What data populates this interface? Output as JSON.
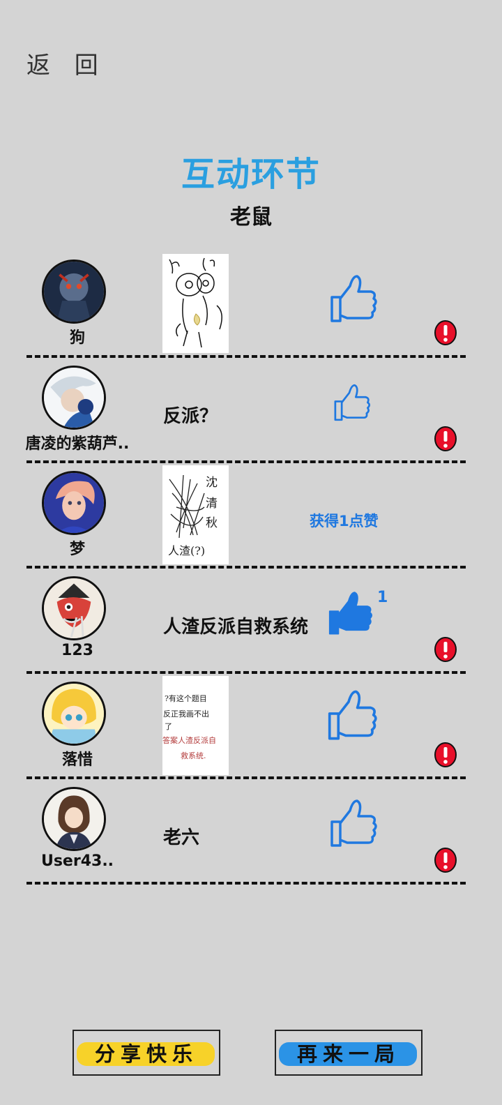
{
  "header": {
    "back_label": "返 回"
  },
  "title": "互动环节",
  "word": "老鼠",
  "players": [
    {
      "name": "狗",
      "answer_type": "drawing",
      "answer": "",
      "like_state": "outline",
      "like_count": "",
      "report": true
    },
    {
      "name": "唐凌的紫葫芦..",
      "answer_type": "text",
      "answer": "反派？",
      "like_state": "outline",
      "like_count": "",
      "report": true
    },
    {
      "name": "梦",
      "answer_type": "drawing",
      "answer": "",
      "like_state": "received",
      "like_text": "获得1点赞",
      "report": false
    },
    {
      "name": "123",
      "answer_type": "text",
      "answer": "人渣反派自救系统",
      "like_state": "filled",
      "like_count": "1",
      "report": true
    },
    {
      "name": "落惜",
      "answer_type": "drawing",
      "answer": "",
      "like_state": "outline",
      "like_count": "",
      "report": true
    },
    {
      "name": "User43..",
      "answer_type": "text",
      "answer": "老六",
      "like_state": "outline",
      "like_count": "",
      "report": true
    }
  ],
  "drawings": {
    "row3_text": [
      "沈",
      "清",
      "秋",
      "人渣(?)"
    ],
    "row5_lines": [
      "?有这个题目",
      "反正我画不出",
      "了",
      "答案人渣反派自",
      "救系统."
    ]
  },
  "buttons": {
    "share": "分享快乐",
    "replay": "再来一局"
  },
  "colors": {
    "background": "#d4d4d4",
    "title": "#2a9fe0",
    "accent_blue": "#1f78e0",
    "share_paint": "#f7d229",
    "replay_paint": "#2b93e6",
    "report_red": "#e8102a"
  }
}
